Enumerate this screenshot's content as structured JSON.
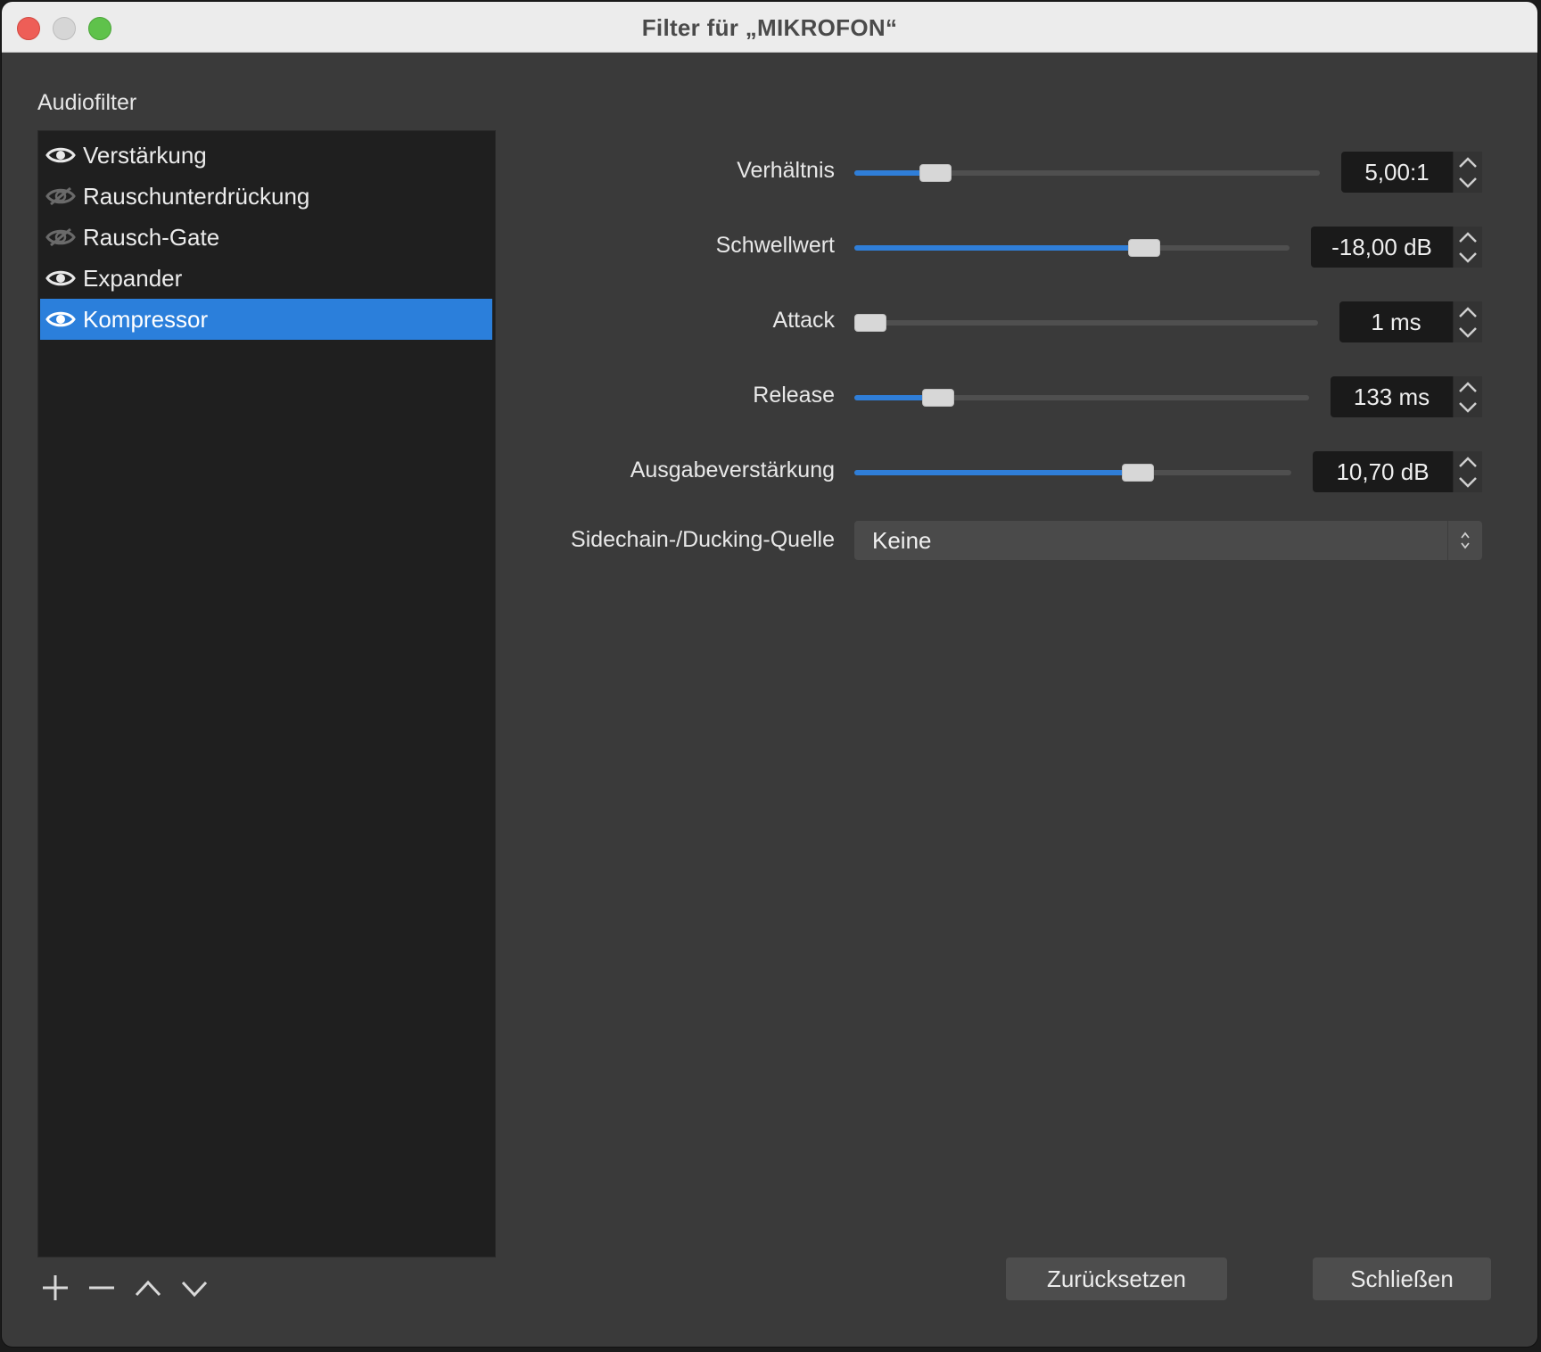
{
  "window": {
    "title": "Filter für „MIKROFON“"
  },
  "sidebar": {
    "label": "Audiofilter",
    "items": [
      {
        "label": "Verstärkung",
        "icon": "eye-icon",
        "visible": true,
        "selected": false
      },
      {
        "label": "Rauschunterdrückung",
        "icon": "eye-slash-icon",
        "visible": false,
        "selected": false
      },
      {
        "label": "Rausch-Gate",
        "icon": "eye-slash-icon",
        "visible": false,
        "selected": false
      },
      {
        "label": "Expander",
        "icon": "eye-icon",
        "visible": true,
        "selected": false
      },
      {
        "label": "Kompressor",
        "icon": "eye-icon",
        "visible": true,
        "selected": true
      }
    ],
    "tools": [
      "plus-icon",
      "minus-icon",
      "chevron-up-icon",
      "chevron-down-icon"
    ]
  },
  "properties": {
    "ratio": {
      "label": "Verhältnis",
      "value": "5,00:1",
      "level": 0.15
    },
    "threshold": {
      "label": "Schwellwert",
      "value": "-18,00 dB",
      "level": 0.68
    },
    "attack": {
      "label": "Attack",
      "value": "1 ms",
      "level": 0.0
    },
    "release": {
      "label": "Release",
      "value": "133 ms",
      "level": 0.16
    },
    "output_gain": {
      "label": "Ausgabeverstärkung",
      "value": "10,70 dB",
      "level": 0.66
    },
    "sidechain": {
      "label": "Sidechain-/Ducking-Quelle",
      "value": "Keine"
    }
  },
  "buttons": {
    "reset": "Zurücksetzen",
    "close": "Schließen"
  },
  "colors": {
    "accent": "#2b7fdb",
    "background": "#3a3a3a",
    "list_background": "#1f1f1f"
  }
}
